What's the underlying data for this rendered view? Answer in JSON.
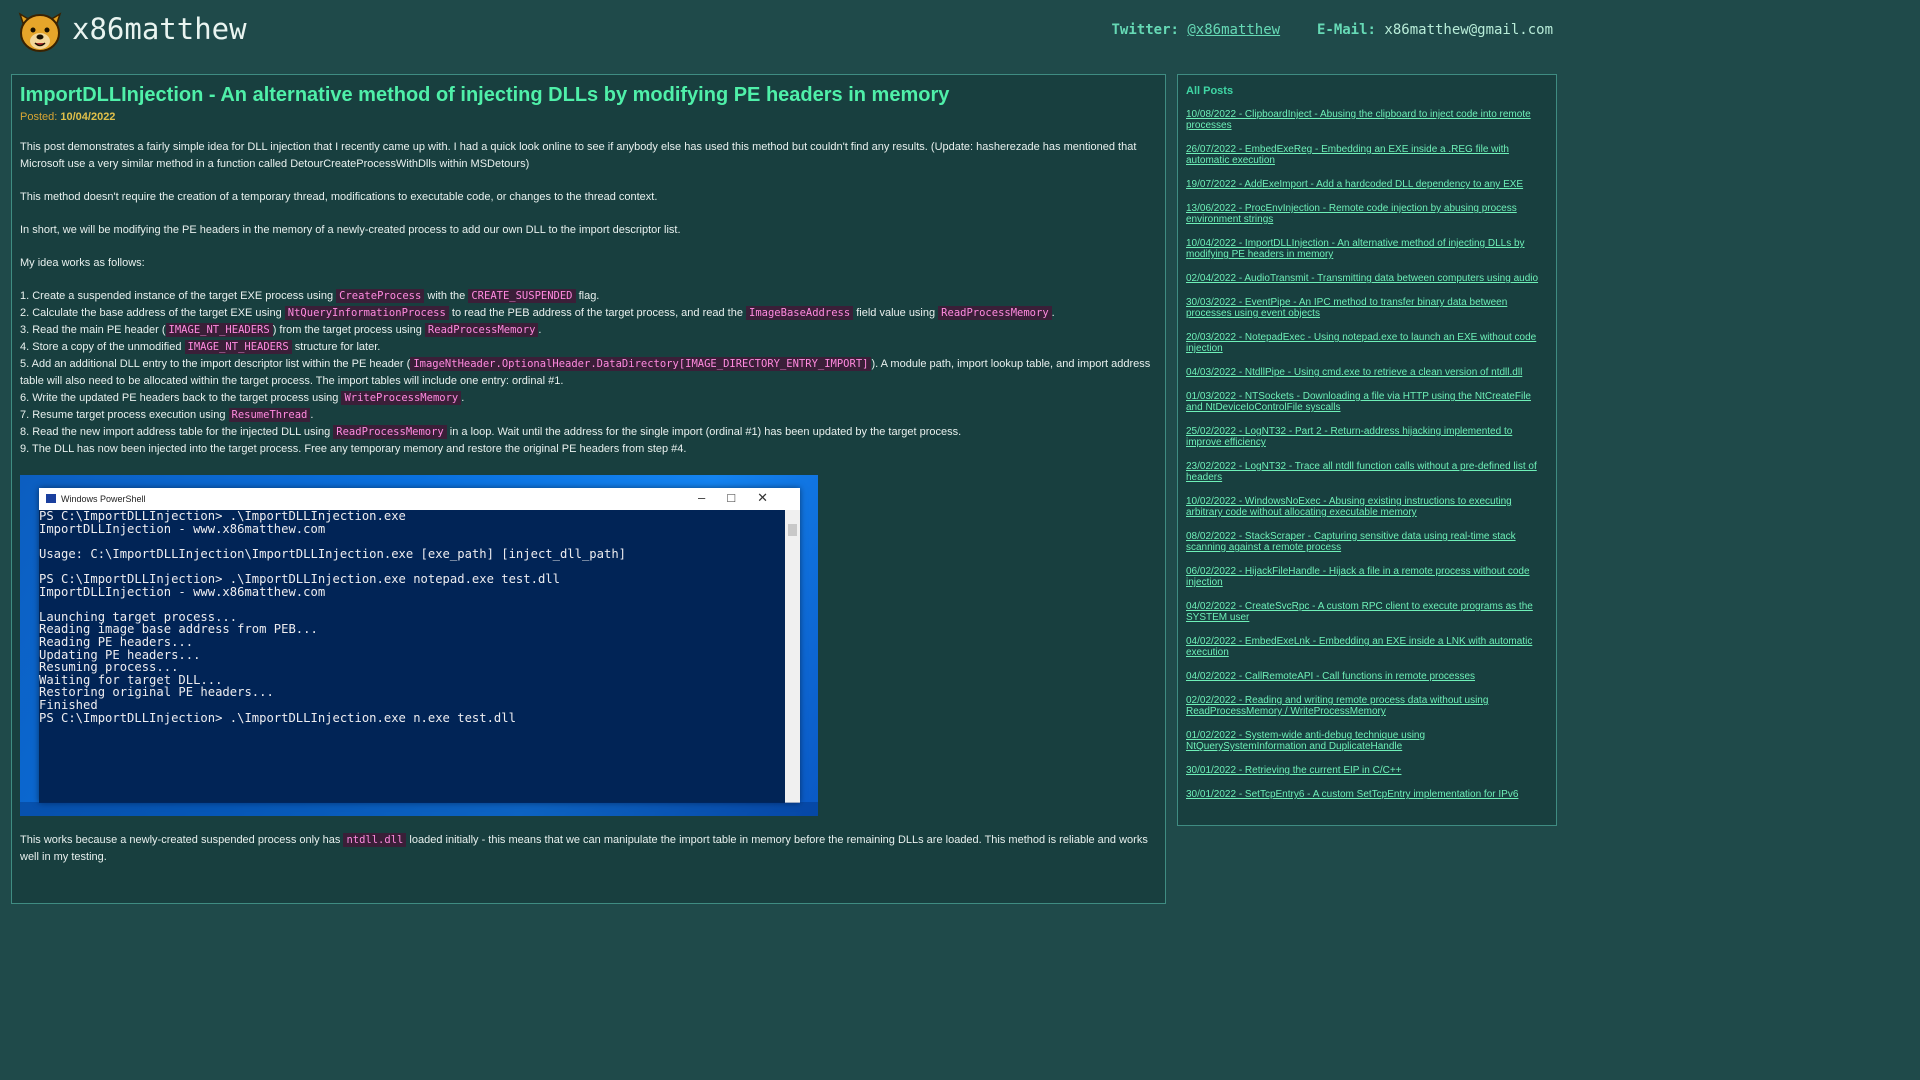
{
  "header": {
    "site_title": "x86matthew",
    "twitter_label": "Twitter:",
    "twitter_handle": "@x86matthew",
    "email_label": "E-Mail:",
    "email": "x86matthew@gmail.com",
    "logo_icon": "bear-logo-icon"
  },
  "post": {
    "title": "ImportDLLInjection - An alternative method of injecting DLLs by modifying PE headers in memory",
    "posted_label": "Posted:",
    "posted_date": "10/04/2022",
    "intro": "This post demonstrates a fairly simple idea for DLL injection that I recently came up with. I had a quick look online to see if anybody else has used this method but couldn't find any results. (Update: hasherezade has mentioned that Microsoft use a very similar method in a function called DetourCreateProcessWithDlls within MSDetours)",
    "p2": "This method doesn't require the creation of a temporary thread, modifications to executable code, or changes to the thread context.",
    "p3": "In short, we will be modifying the PE headers in the memory of a newly-created process to add our own DLL to the import descriptor list.",
    "p4": "My idea works as follows:",
    "steps": [
      {
        "a": "1. Create a suspended instance of the target EXE process using ",
        "c1": "CreateProcess",
        "b": " with the ",
        "c2": "CREATE_SUSPENDED",
        "d": " flag."
      },
      {
        "a": "2. Calculate the base address of the target EXE using ",
        "c1": "NtQueryInformationProcess",
        "b": " to read the PEB address of the target process, and read the ",
        "c2": "ImageBaseAddress",
        "d": " field value using ",
        "c3": "ReadProcessMemory",
        "e": "."
      },
      {
        "a": "3. Read the main PE header (",
        "c1": "IMAGE_NT_HEADERS",
        "b": ") from the target process using ",
        "c2": "ReadProcessMemory",
        "d": "."
      },
      {
        "a": "4. Store a copy of the unmodified ",
        "c1": "IMAGE_NT_HEADERS",
        "b": " structure for later."
      },
      {
        "a": "5. Add an additional DLL entry to the import descriptor list within the PE header (",
        "c1": "ImageNtHeader.OptionalHeader.DataDirectory[IMAGE_DIRECTORY_ENTRY_IMPORT]",
        "b": "). A module path, import lookup table, and import address table will also need to be allocated within the target process. The import tables will include one entry: ordinal #1."
      },
      {
        "a": "6. Write the updated PE headers back to the target process using ",
        "c1": "WriteProcessMemory",
        "b": "."
      },
      {
        "a": "7. Resume target process execution using ",
        "c1": "ResumeThread",
        "b": "."
      },
      {
        "a": "8. Read the new import address table for the injected DLL using ",
        "c1": "ReadProcessMemory",
        "b": " in a loop. Wait until the address for the single import (ordinal #1) has been updated by the target process."
      },
      {
        "a": "9. The DLL has now been injected into the target process. Free any temporary memory and restore the original PE headers from step #4."
      }
    ],
    "screenshot": {
      "window_title": "Windows PowerShell",
      "controls": "–□✕",
      "console": "PS C:\\ImportDLLInjection> .\\ImportDLLInjection.exe\nImportDLLInjection - www.x86matthew.com\n\nUsage: C:\\ImportDLLInjection\\ImportDLLInjection.exe [exe_path] [inject_dll_path]\n\nPS C:\\ImportDLLInjection> .\\ImportDLLInjection.exe notepad.exe test.dll\nImportDLLInjection - www.x86matthew.com\n\nLaunching target process...\nReading image base address from PEB...\nReading PE headers...\nUpdating PE headers...\nResuming process...\nWaiting for target DLL...\nRestoring original PE headers...\nFinished\nPS C:\\ImportDLLInjection> .\\ImportDLLInjection.exe n.exe test.dll"
    },
    "p5_a": "This works because a newly-created suspended process only has ",
    "p5_code": "ntdll.dll",
    "p5_b": " loaded initially - this means that we can manipulate the import table in memory before the remaining DLLs are loaded. This method is reliable and works well in my testing."
  },
  "sidebar": {
    "title": "All Posts",
    "posts": [
      "10/08/2022 - ClipboardInject - Abusing the clipboard to inject code into remote processes",
      "26/07/2022 - EmbedExeReg - Embedding an EXE inside a .REG file with automatic execution",
      "19/07/2022 - AddExeImport - Add a hardcoded DLL dependency to any EXE",
      "13/06/2022 - ProcEnvInjection - Remote code injection by abusing process environment strings",
      "10/04/2022 - ImportDLLInjection - An alternative method of injecting DLLs by modifying PE headers in memory",
      "02/04/2022 - AudioTransmit - Transmitting data between computers using audio",
      "30/03/2022 - EventPipe - An IPC method to transfer binary data between processes using event objects",
      "20/03/2022 - NotepadExec - Using notepad.exe to launch an EXE without code injection",
      "04/03/2022 - NtdllPipe - Using cmd.exe to retrieve a clean version of ntdll.dll",
      "01/03/2022 - NTSockets - Downloading a file via HTTP using the NtCreateFile and NtDeviceIoControlFile syscalls",
      "25/02/2022 - LogNT32 - Part 2 - Return-address hijacking implemented to improve efficiency",
      "23/02/2022 - LogNT32 - Trace all ntdll function calls without a pre-defined list of headers",
      "10/02/2022 - WindowsNoExec - Abusing existing instructions to executing arbitrary code without allocating executable memory",
      "08/02/2022 - StackScraper - Capturing sensitive data using real-time stack scanning against a remote process",
      "06/02/2022 - HijackFileHandle - Hijack a file in a remote process without code injection",
      "04/02/2022 - CreateSvcRpc - A custom RPC client to execute programs as the SYSTEM user",
      "04/02/2022 - EmbedExeLnk - Embedding an EXE inside a LNK with automatic execution",
      "04/02/2022 - CallRemoteAPI - Call functions in remote processes",
      "02/02/2022 - Reading and writing remote process data without using ReadProcessMemory / WriteProcessMemory",
      "01/02/2022 - System-wide anti-debug technique using NtQuerySystemInformation and DuplicateHandle",
      "30/01/2022 - Retrieving the current EIP in C/C++",
      "30/01/2022 - SetTcpEntry6 - A custom SetTcpEntry implementation for IPv6"
    ]
  }
}
